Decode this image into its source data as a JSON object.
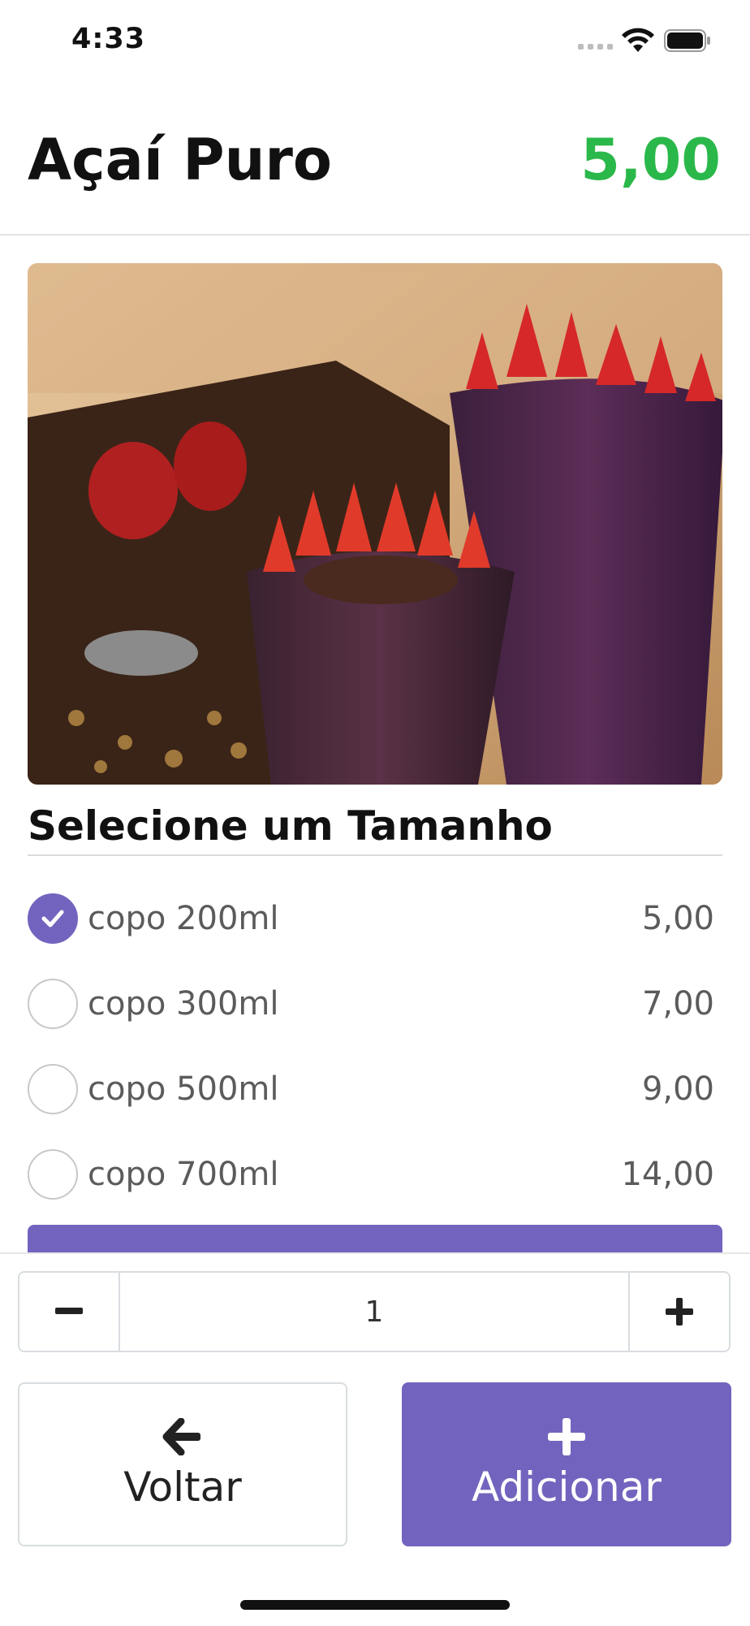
{
  "status_bar": {
    "time": "4:33"
  },
  "header": {
    "title": "Açaí Puro",
    "price": "5,00"
  },
  "image": {
    "alt": "açaí cups with strawberries"
  },
  "sizes": {
    "heading": "Selecione um Tamanho",
    "options": [
      {
        "label": "copo 200ml",
        "price": "5,00",
        "selected": true
      },
      {
        "label": "copo 300ml",
        "price": "7,00",
        "selected": false
      },
      {
        "label": "copo 500ml",
        "price": "9,00",
        "selected": false
      },
      {
        "label": "copo 700ml",
        "price": "14,00",
        "selected": false
      }
    ]
  },
  "quantity": {
    "value": "1",
    "minus_icon": "minus-icon",
    "plus_icon": "plus-icon"
  },
  "actions": {
    "back_label": "Voltar",
    "back_icon": "arrow-left-icon",
    "add_label": "Adicionar",
    "add_icon": "plus-icon"
  },
  "colors": {
    "accent": "#7264be",
    "price_green": "#2bb84a"
  }
}
